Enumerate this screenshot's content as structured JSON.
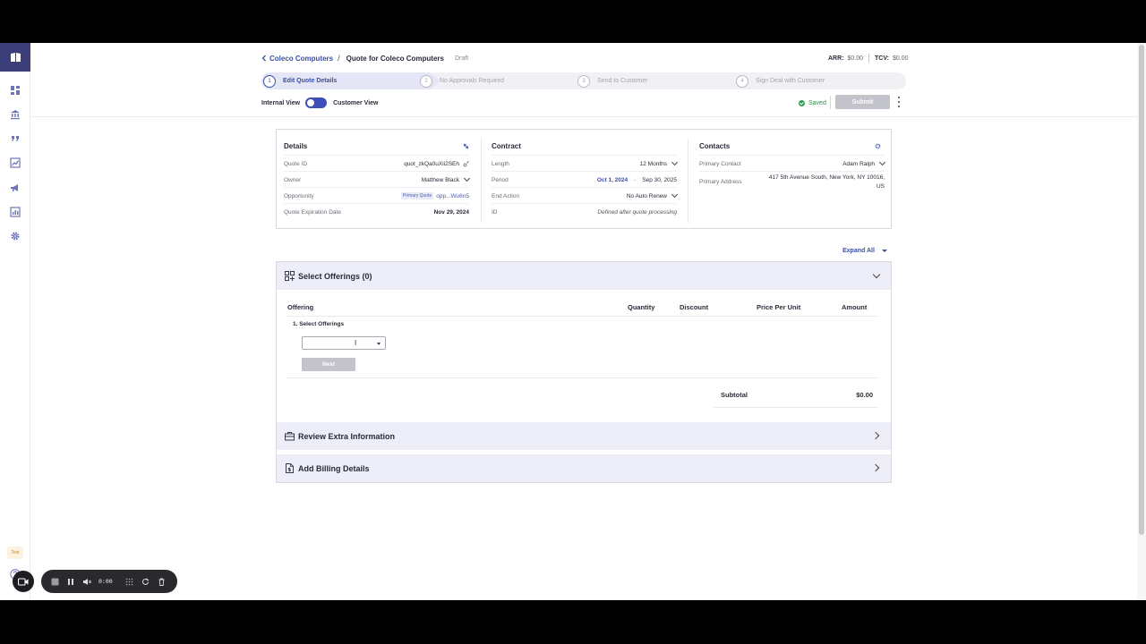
{
  "breadcrumb": {
    "parent": "Coleco Computers",
    "current": "Quote for Coleco Computers",
    "status": "Draft"
  },
  "metrics": {
    "arr_label": "ARR:",
    "arr_value": "$0.00",
    "tcv_label": "TCV:",
    "tcv_value": "$0.00"
  },
  "stepper": [
    {
      "num": "1",
      "label": "Edit Quote Details"
    },
    {
      "num": "2",
      "label": "No Approvals Required"
    },
    {
      "num": "3",
      "label": "Send to Customer"
    },
    {
      "num": "4",
      "label": "Sign Deal with Customer"
    }
  ],
  "view_toggle": {
    "left": "Internal View",
    "right": "Customer View"
  },
  "save_status": "Saved",
  "submit_label": "Submit",
  "details": {
    "title": "Details",
    "quote_id_label": "Quote ID",
    "quote_id": "quot_zkQa0uXii2SEh",
    "owner_label": "Owner",
    "owner": "Matthew Black",
    "opportunity_label": "Opportunity",
    "opportunity_tag": "Primary Quote",
    "opportunity": "opp...Wu6n5",
    "expiration_label": "Quote Expiration Date",
    "expiration": "Nov 29, 2024"
  },
  "contract": {
    "title": "Contract",
    "length_label": "Length",
    "length": "12 Months",
    "period_label": "Period",
    "period_start": "Oct 1, 2024",
    "period_sep": "-",
    "period_end": "Sep 30, 2025",
    "end_action_label": "End Action",
    "end_action": "No Auto Renew",
    "id_label": "ID",
    "id_value": "Defined after quote processing"
  },
  "contacts": {
    "title": "Contacts",
    "primary_contact_label": "Primary Contact",
    "primary_contact": "Adam Ralph",
    "primary_address_label": "Primary Address",
    "address_line1": "417 5th Avenue South, New York, NY 10016,",
    "address_line2": "US"
  },
  "expand_all": "Expand All",
  "offerings": {
    "title": "Select Offerings (0)",
    "columns": {
      "offering": "Offering",
      "quantity": "Quantity",
      "discount": "Discount",
      "price": "Price Per Unit",
      "amount": "Amount"
    },
    "step_label": "1.  Select Offerings",
    "next_label": "Next",
    "subtotal_label": "Subtotal",
    "subtotal_value": "$0.00"
  },
  "sections": {
    "extra": "Review Extra Information",
    "billing": "Add Billing Details"
  },
  "sidebar": {
    "test_badge": "Test"
  },
  "recorder": {
    "time": "0:00"
  },
  "colors": {
    "brand": "#3c3e7a",
    "accent": "#3b4fa3",
    "toggle": "#3c4fb8",
    "saved": "#2f9e52"
  }
}
